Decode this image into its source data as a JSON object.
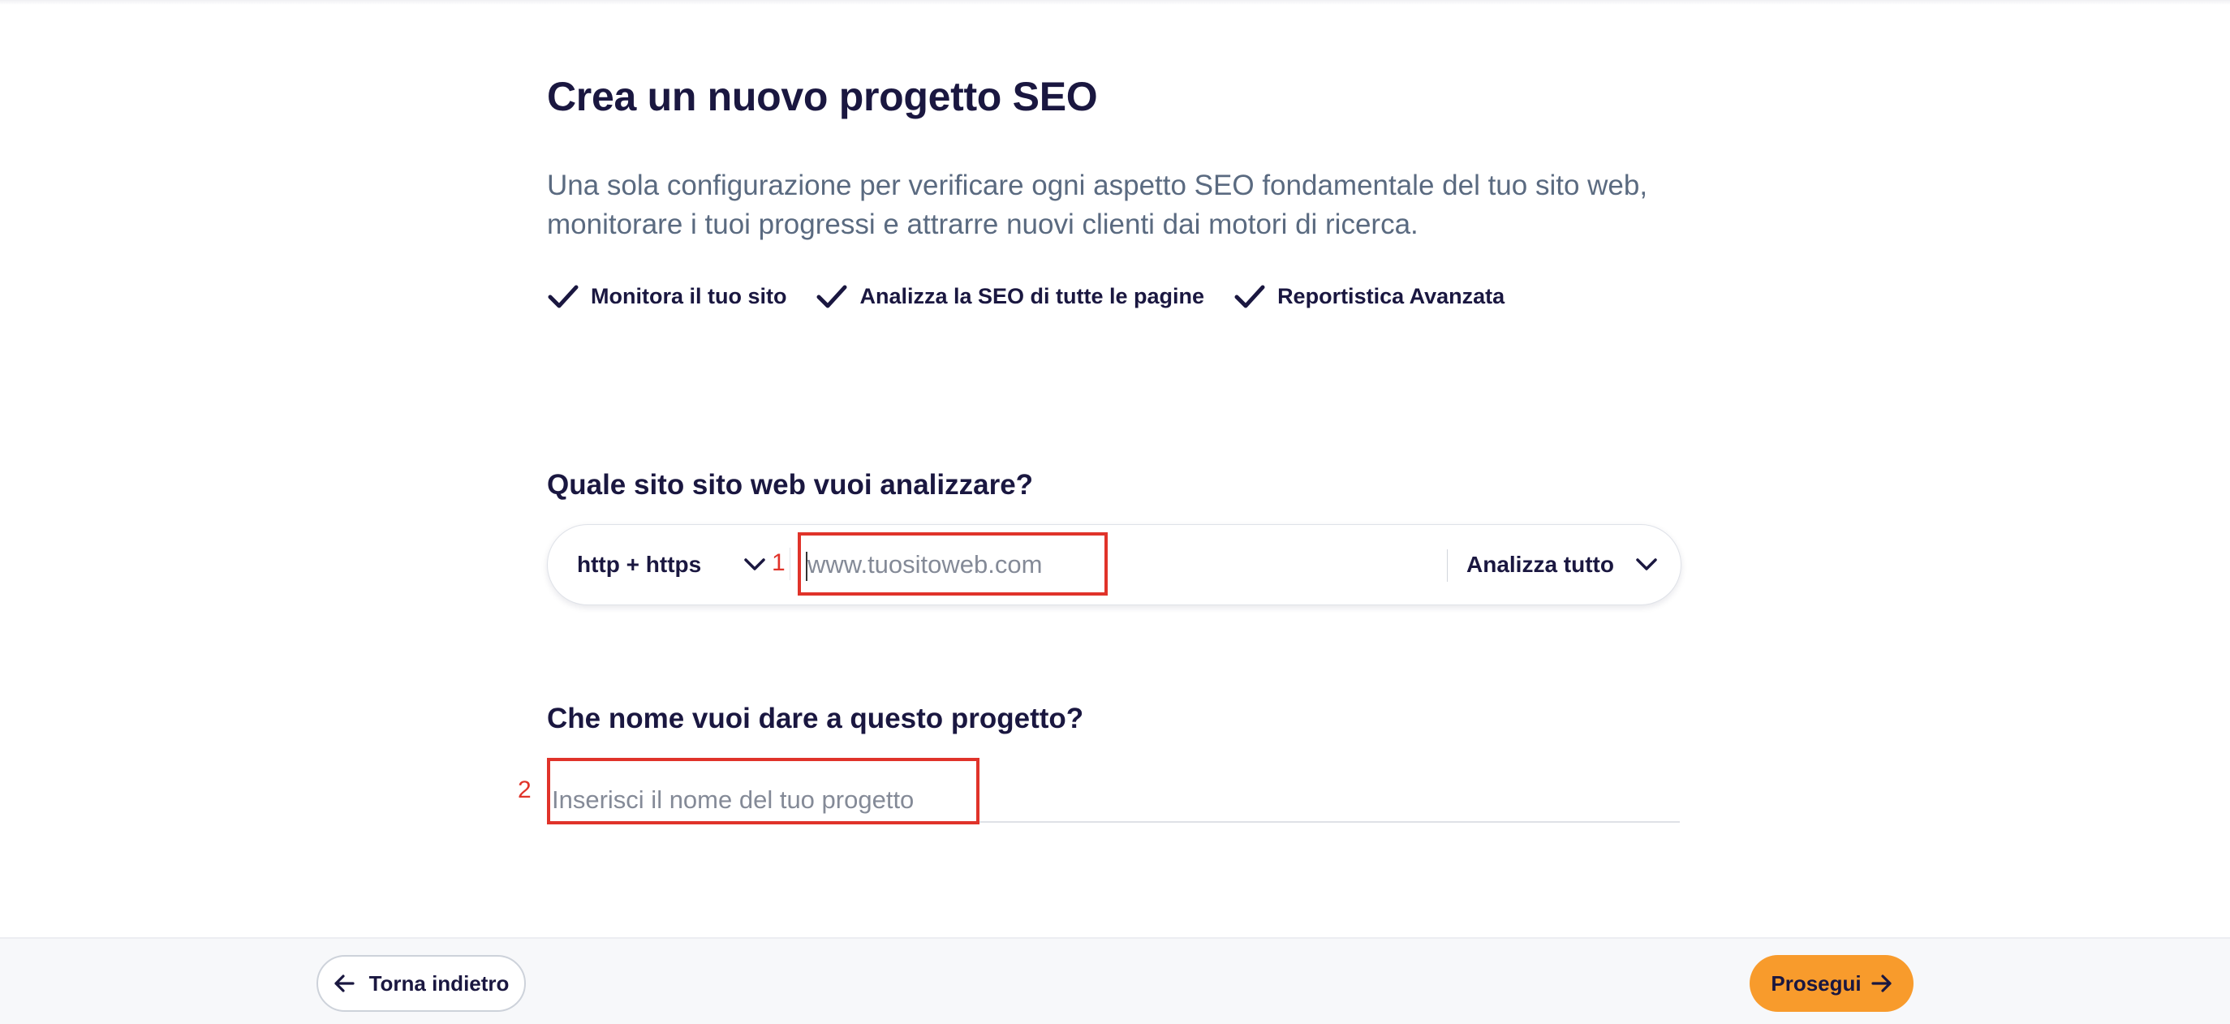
{
  "header": {
    "title": "Crea un nuovo progetto SEO",
    "subtitle": "Una sola configurazione per verificare ogni aspetto SEO fondamentale del tuo sito web, monitorare i tuoi progressi e attrarre nuovi clienti dai motori di ricerca."
  },
  "features": [
    {
      "label": "Monitora il tuo sito",
      "icon": "check-icon"
    },
    {
      "label": "Analizza la SEO di tutte le pagine",
      "icon": "check-icon"
    },
    {
      "label": "Reportistica Avanzata",
      "icon": "check-icon"
    }
  ],
  "website": {
    "question": "Quale sito sito web vuoi analizzare?",
    "protocol": "http + https",
    "url_placeholder": "www.tuositoweb.com",
    "url_value": "",
    "scope": "Analizza tutto",
    "annotation": "1"
  },
  "project": {
    "question": "Che nome vuoi dare a questo progetto?",
    "name_placeholder": "Inserisci il nome del tuo progetto",
    "name_value": "",
    "annotation": "2"
  },
  "footer": {
    "back_label": "Torna indietro",
    "next_label": "Prosegui"
  },
  "colors": {
    "primary_text": "#1a1740",
    "accent": "#f89b2c",
    "annotation": "#e0332a"
  }
}
